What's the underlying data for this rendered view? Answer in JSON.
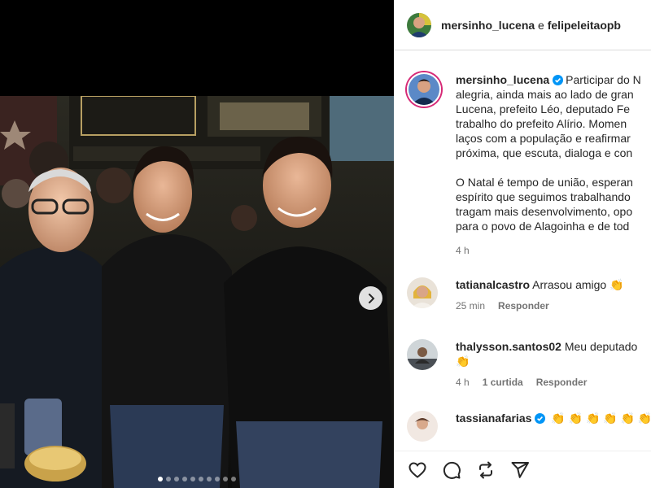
{
  "post": {
    "header": {
      "author": "mersinho_lucena",
      "connector": "e",
      "coauthor": "felipeleitaopb"
    },
    "caption": {
      "username": "mersinho_lucena",
      "lines": [
        "Participar do N",
        "alegria, ainda mais ao lado de gran",
        "Lucena, prefeito Léo, deputado Fe",
        "trabalho do prefeito Alírio. Momen",
        "laços com a população e reafirmar",
        "próxima, que escuta, dialoga e con"
      ],
      "paragraph2": [
        "O Natal é tempo de união, esperan",
        "espírito que seguimos trabalhando",
        "tragam mais desenvolvimento, opo",
        "para o povo de Alagoinha e de tod"
      ],
      "time": "4 h"
    },
    "comments": [
      {
        "username": "tatianalcastro",
        "text": "Arrasou amigo",
        "emoji": "👏",
        "time": "25 min",
        "reply": "Responder"
      },
      {
        "username": "thalysson.santos02",
        "text": "Meu deputado",
        "emoji_line": "👏",
        "time": "4 h",
        "likes": "1 curtida",
        "reply": "Responder"
      },
      {
        "username": "tassianafarias",
        "emoji_line": "👏 👏 👏 👏 👏 👏"
      }
    ],
    "actions": [
      "heart-icon",
      "comment-icon",
      "share-icon",
      "send-icon"
    ],
    "carousel": {
      "slides": 10,
      "active_index": 0
    },
    "colors": {
      "verified": "#0095f6",
      "story_ring": "#d62976",
      "text": "#262626",
      "muted": "#737373"
    }
  }
}
